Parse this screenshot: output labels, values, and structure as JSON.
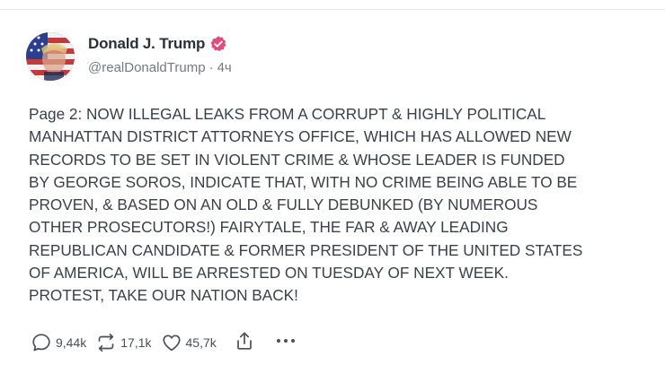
{
  "post": {
    "author": {
      "display_name": "Donald J. Trump",
      "handle": "@realDonaldTrump",
      "separator": "·",
      "time_ago": "4ч",
      "verified": true,
      "verified_color": "#e24b7a"
    },
    "text": "Page 2: NOW ILLEGAL LEAKS FROM A CORRUPT & HIGHLY POLITICAL\nMANHATTAN DISTRICT ATTORNEYS OFFICE, WHICH HAS ALLOWED NEW\nRECORDS TO BE SET IN VIOLENT CRIME & WHOSE LEADER IS FUNDED\nBY GEORGE SOROS, INDICATE THAT, WITH NO CRIME BEING ABLE TO BE\nPROVEN, & BASED ON AN OLD & FULLY DEBUNKED (BY NUMEROUS\nOTHER PROSECUTORS!) FAIRYTALE, THE FAR & AWAY LEADING\nREPUBLICAN CANDIDATE & FORMER PRESIDENT OF THE UNITED STATES\nOF AMERICA, WILL BE ARRESTED ON TUESDAY OF NEXT WEEK.\nPROTEST, TAKE OUR NATION BACK!",
    "actions": {
      "replies": "9,44k",
      "reposts": "17,1k",
      "likes": "45,7k",
      "reply_icon": "comment-icon",
      "repost_icon": "repost-icon",
      "like_icon": "heart-icon",
      "share_icon": "share-icon",
      "more_icon": "more-icon"
    }
  }
}
